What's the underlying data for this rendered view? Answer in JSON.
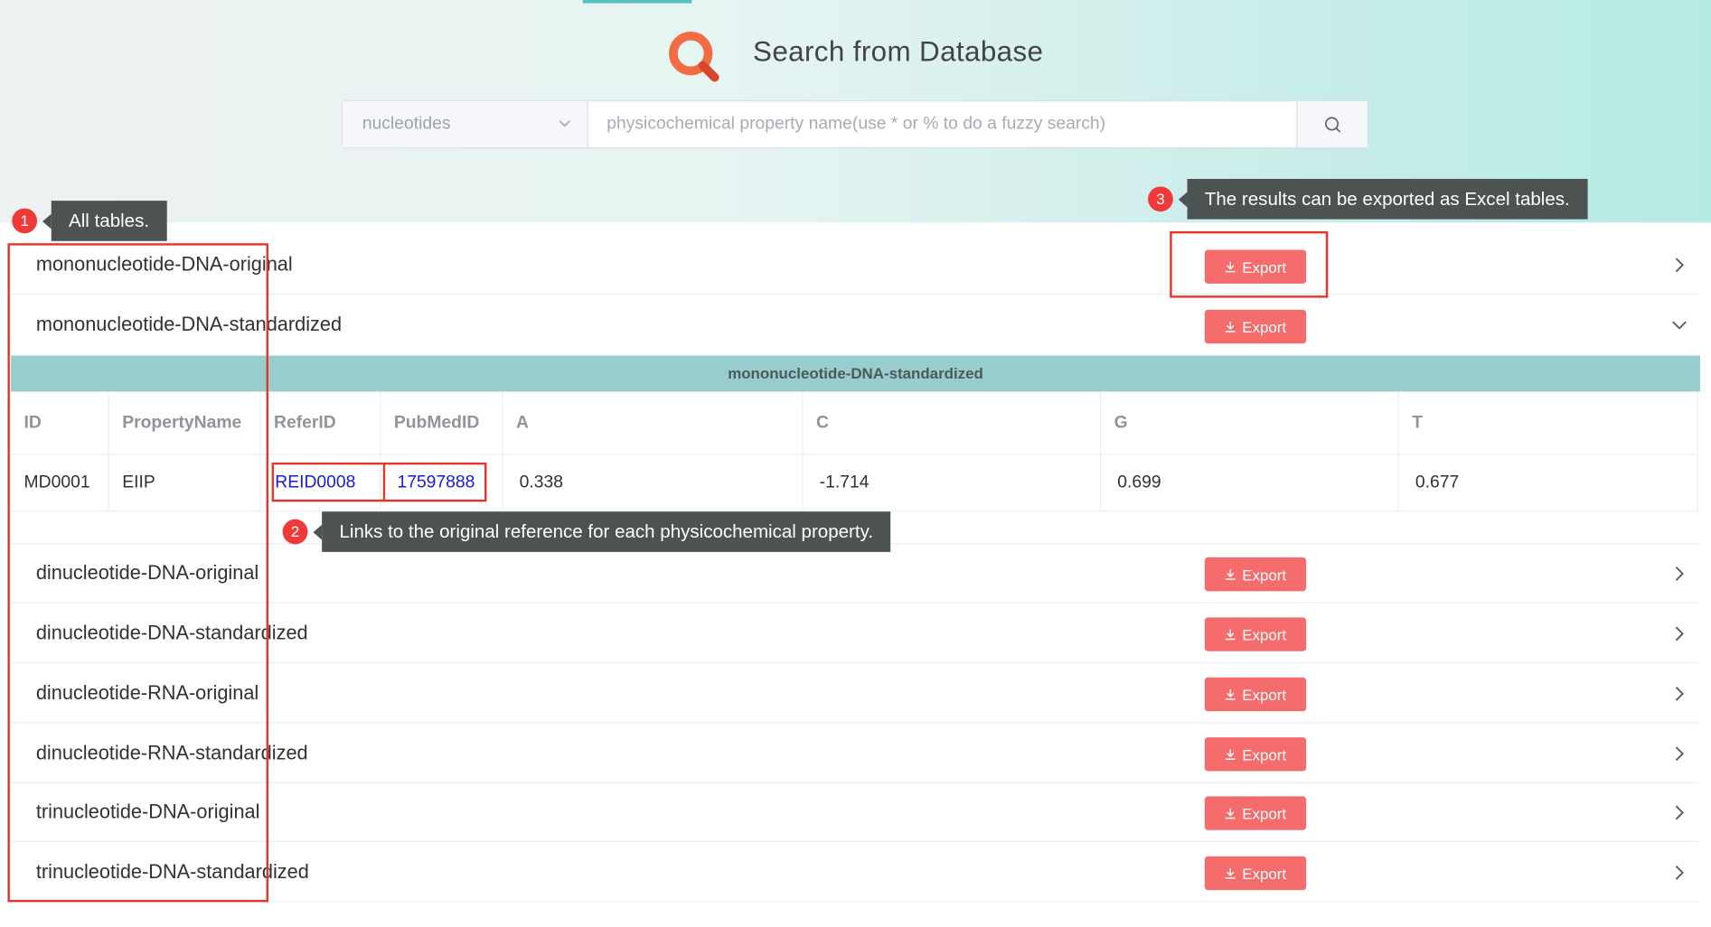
{
  "header": {
    "title": "Search from Database",
    "search": {
      "select_value": "nucleotides",
      "placeholder": "physicochemical property name(use * or % to do a fuzzy search)"
    }
  },
  "export_label": "Export",
  "tables": [
    {
      "name": "mononucleotide-DNA-original",
      "expanded": false
    },
    {
      "name": "mononucleotide-DNA-standardized",
      "expanded": true
    },
    {
      "name": "dinucleotide-DNA-original",
      "expanded": false
    },
    {
      "name": "dinucleotide-DNA-standardized",
      "expanded": false
    },
    {
      "name": "dinucleotide-RNA-original",
      "expanded": false
    },
    {
      "name": "dinucleotide-RNA-standardized",
      "expanded": false
    },
    {
      "name": "trinucleotide-DNA-original",
      "expanded": false
    },
    {
      "name": "trinucleotide-DNA-standardized",
      "expanded": false
    }
  ],
  "expanded_table": {
    "title": "mononucleotide-DNA-standardized",
    "columns": [
      "ID",
      "PropertyName",
      "ReferID",
      "PubMedID",
      "A",
      "C",
      "G",
      "T"
    ],
    "rows": [
      [
        "MD0001",
        "EIIP",
        "REID0008",
        "17597888",
        "0.338",
        "-1.714",
        "0.699",
        "0.677"
      ]
    ]
  },
  "annotations": [
    {
      "number": "1",
      "text": "All tables."
    },
    {
      "number": "2",
      "text": "Links to the original reference for each physicochemical property."
    },
    {
      "number": "3",
      "text": "The results can be exported as Excel tables."
    }
  ],
  "colors": {
    "export_button": "#f56c6c",
    "table_title_bar": "#99cdcd",
    "annotation_red": "#e8352b",
    "tooltip_bg": "#4d5353",
    "link": "#1a1adb"
  }
}
